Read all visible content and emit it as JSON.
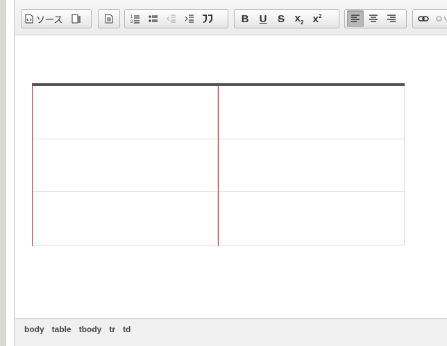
{
  "toolbar": {
    "source_label": "ソース",
    "buttons": [
      "source-icon",
      "maximize-icon",
      "document-icon",
      "numbered-list-icon",
      "bulleted-list-icon",
      "outdent-icon",
      "indent-icon",
      "blockquote-icon",
      "bold",
      "underline",
      "strikethrough",
      "subscript",
      "superscript",
      "align-left-icon",
      "align-center-icon",
      "align-right-icon",
      "link-icon",
      "unlink-icon"
    ],
    "format": {
      "bold": "B",
      "underline": "U",
      "strike": "S",
      "sub_base": "x",
      "sub_mark": "2",
      "sup_base": "x",
      "sup_mark": "2"
    },
    "active_button": "align-left"
  },
  "editor": {
    "table": {
      "rows": 3,
      "cols": 2
    }
  },
  "statusbar": {
    "path": [
      "body",
      "table",
      "tbody",
      "tr",
      "td"
    ]
  },
  "colors": {
    "accent_red": "#d72a2a",
    "table_top_border": "#555555",
    "toolbar_bg": "#ececec"
  }
}
